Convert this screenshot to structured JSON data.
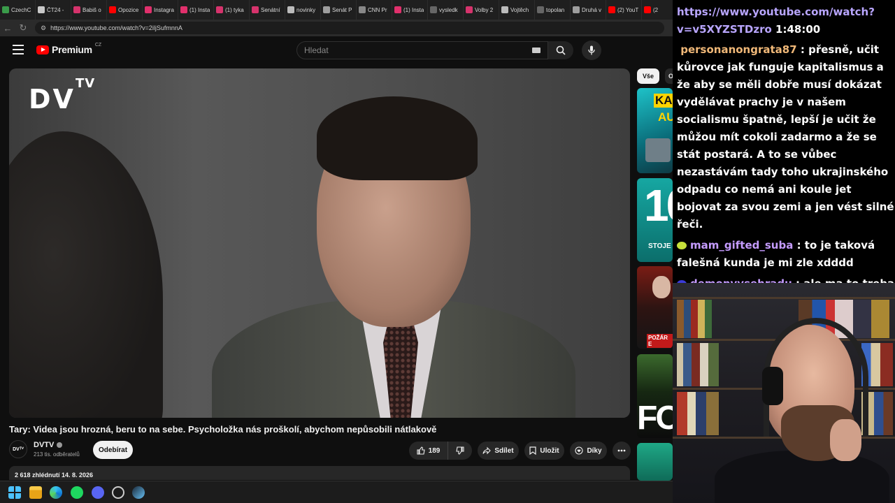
{
  "browser": {
    "tabs": [
      {
        "label": "CzechC",
        "color": "#3a9b4a"
      },
      {
        "label": "ČT24 -",
        "color": "#c8c8c8"
      },
      {
        "label": "Babiš o",
        "color": "#d6336c"
      },
      {
        "label": "Opozice",
        "color": "#ff0000"
      },
      {
        "label": "Instagra",
        "color": "#e1306c"
      },
      {
        "label": "(1) Insta",
        "color": "#e1306c"
      },
      {
        "label": "(1) tyka",
        "color": "#d6336c"
      },
      {
        "label": "Senátní",
        "color": "#d6336c"
      },
      {
        "label": "novinky",
        "color": "#bbbbbb"
      },
      {
        "label": "Senát P",
        "color": "#9e9e9e"
      },
      {
        "label": "CNN Pr",
        "color": "#888888"
      },
      {
        "label": "(1) Insta",
        "color": "#e1306c"
      },
      {
        "label": "vysledk",
        "color": "#666666"
      },
      {
        "label": "Volby 2",
        "color": "#d6336c"
      },
      {
        "label": "Vojtěch",
        "color": "#bbbbbb"
      },
      {
        "label": "topolan",
        "color": "#666666"
      },
      {
        "label": "Druhá v",
        "color": "#9e9e9e"
      },
      {
        "label": "(2) YouT",
        "color": "#ff0000"
      },
      {
        "label": "(2",
        "color": "#ff0000"
      }
    ],
    "url": "https://www.youtube.com/watch?v=2iljSufmnnA"
  },
  "youtube": {
    "logo_text": "Premium",
    "logo_region": "CZ",
    "search_placeholder": "Hledat",
    "video_watermark": "DV",
    "video_watermark_sup": "TV",
    "title": "Tary: Videa jsou hrozná, beru to na sebe. Psycholožka nás proškolí, abychom nepůsobili nátlakově",
    "channel_avatar": "DVᵀⱽ",
    "channel_name": "DVTV",
    "subscribers": "213 tis. odběratelů",
    "subscribe_label": "Odebírat",
    "likes": "189",
    "share_label": "Sdílet",
    "save_label": "Uložit",
    "thanks_label": "Díky",
    "views_date": "2 618 zhlédnutí  14. 8. 2026",
    "chip_all": "Vše",
    "chip_other": "O",
    "related": [
      {
        "text": "KAN",
        "text2": "AU"
      },
      {
        "text": "10",
        "text2": "STOJE"
      },
      {
        "text": "POŽÁR E"
      },
      {
        "text": "FO"
      },
      {
        "text": ""
      }
    ]
  },
  "overlay": {
    "url_line1": "https://www.youtube.com/watch?",
    "url_line2": "v=v5XYZSTDzro",
    "timestamp": "1:48:00",
    "messages": [
      {
        "nick": "personanongrata87",
        "text": ": přesně, učit kůrovce jak funguje kapitalismus a že aby se měli dobře musí dokázat vydělávat prachy je v našem socialismu špatně, lepší je učit že můžou mít cokoli zadarmo a že se stát postará. A to se vůbec nezastávám tady toho ukrajinského odpadu co nemá ani koule jet bojovat za svou zemi a jen vést silné řeči."
      },
      {
        "nick": "mam_gifted_suba",
        "text": ": to je taková falešná kunda je mi zle xdddd",
        "badge_color": "#c6e03a"
      },
      {
        "nick": "demonvysehradu",
        "text": ": ale ma to treba hodinu",
        "badge_color": "#3b3bd9"
      }
    ]
  }
}
